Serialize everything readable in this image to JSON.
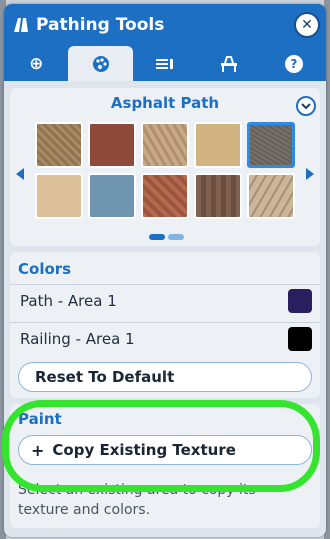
{
  "window": {
    "title": "Pathing Tools",
    "close_icon": "close-icon",
    "tabs": [
      {
        "icon": "plus-icon",
        "glyph": "⊕",
        "active": false
      },
      {
        "icon": "palette-icon",
        "glyph": "◉",
        "active": true
      },
      {
        "icon": "properties-icon",
        "glyph": "▤",
        "active": false
      },
      {
        "icon": "path-settings-icon",
        "glyph": "⛓",
        "active": false
      },
      {
        "icon": "help-icon",
        "glyph": "?",
        "active": false
      }
    ]
  },
  "texture_panel": {
    "title": "Asphalt Path",
    "selected_index": 4,
    "page": 1,
    "page_count": 2
  },
  "colors_panel": {
    "title": "Colors",
    "rows": [
      {
        "label": "Path - Area 1",
        "color": "#2a1f5e"
      },
      {
        "label": "Railing - Area 1",
        "color": "#000000"
      }
    ],
    "reset_label": "Reset To Default"
  },
  "paint_panel": {
    "title": "Paint",
    "button_label": "Copy Existing Texture",
    "help_text": "Select an existing area to copy its texture and colors."
  },
  "colors": {
    "accent": "#1d6fc4",
    "highlight_annotation": "#35e52d"
  }
}
